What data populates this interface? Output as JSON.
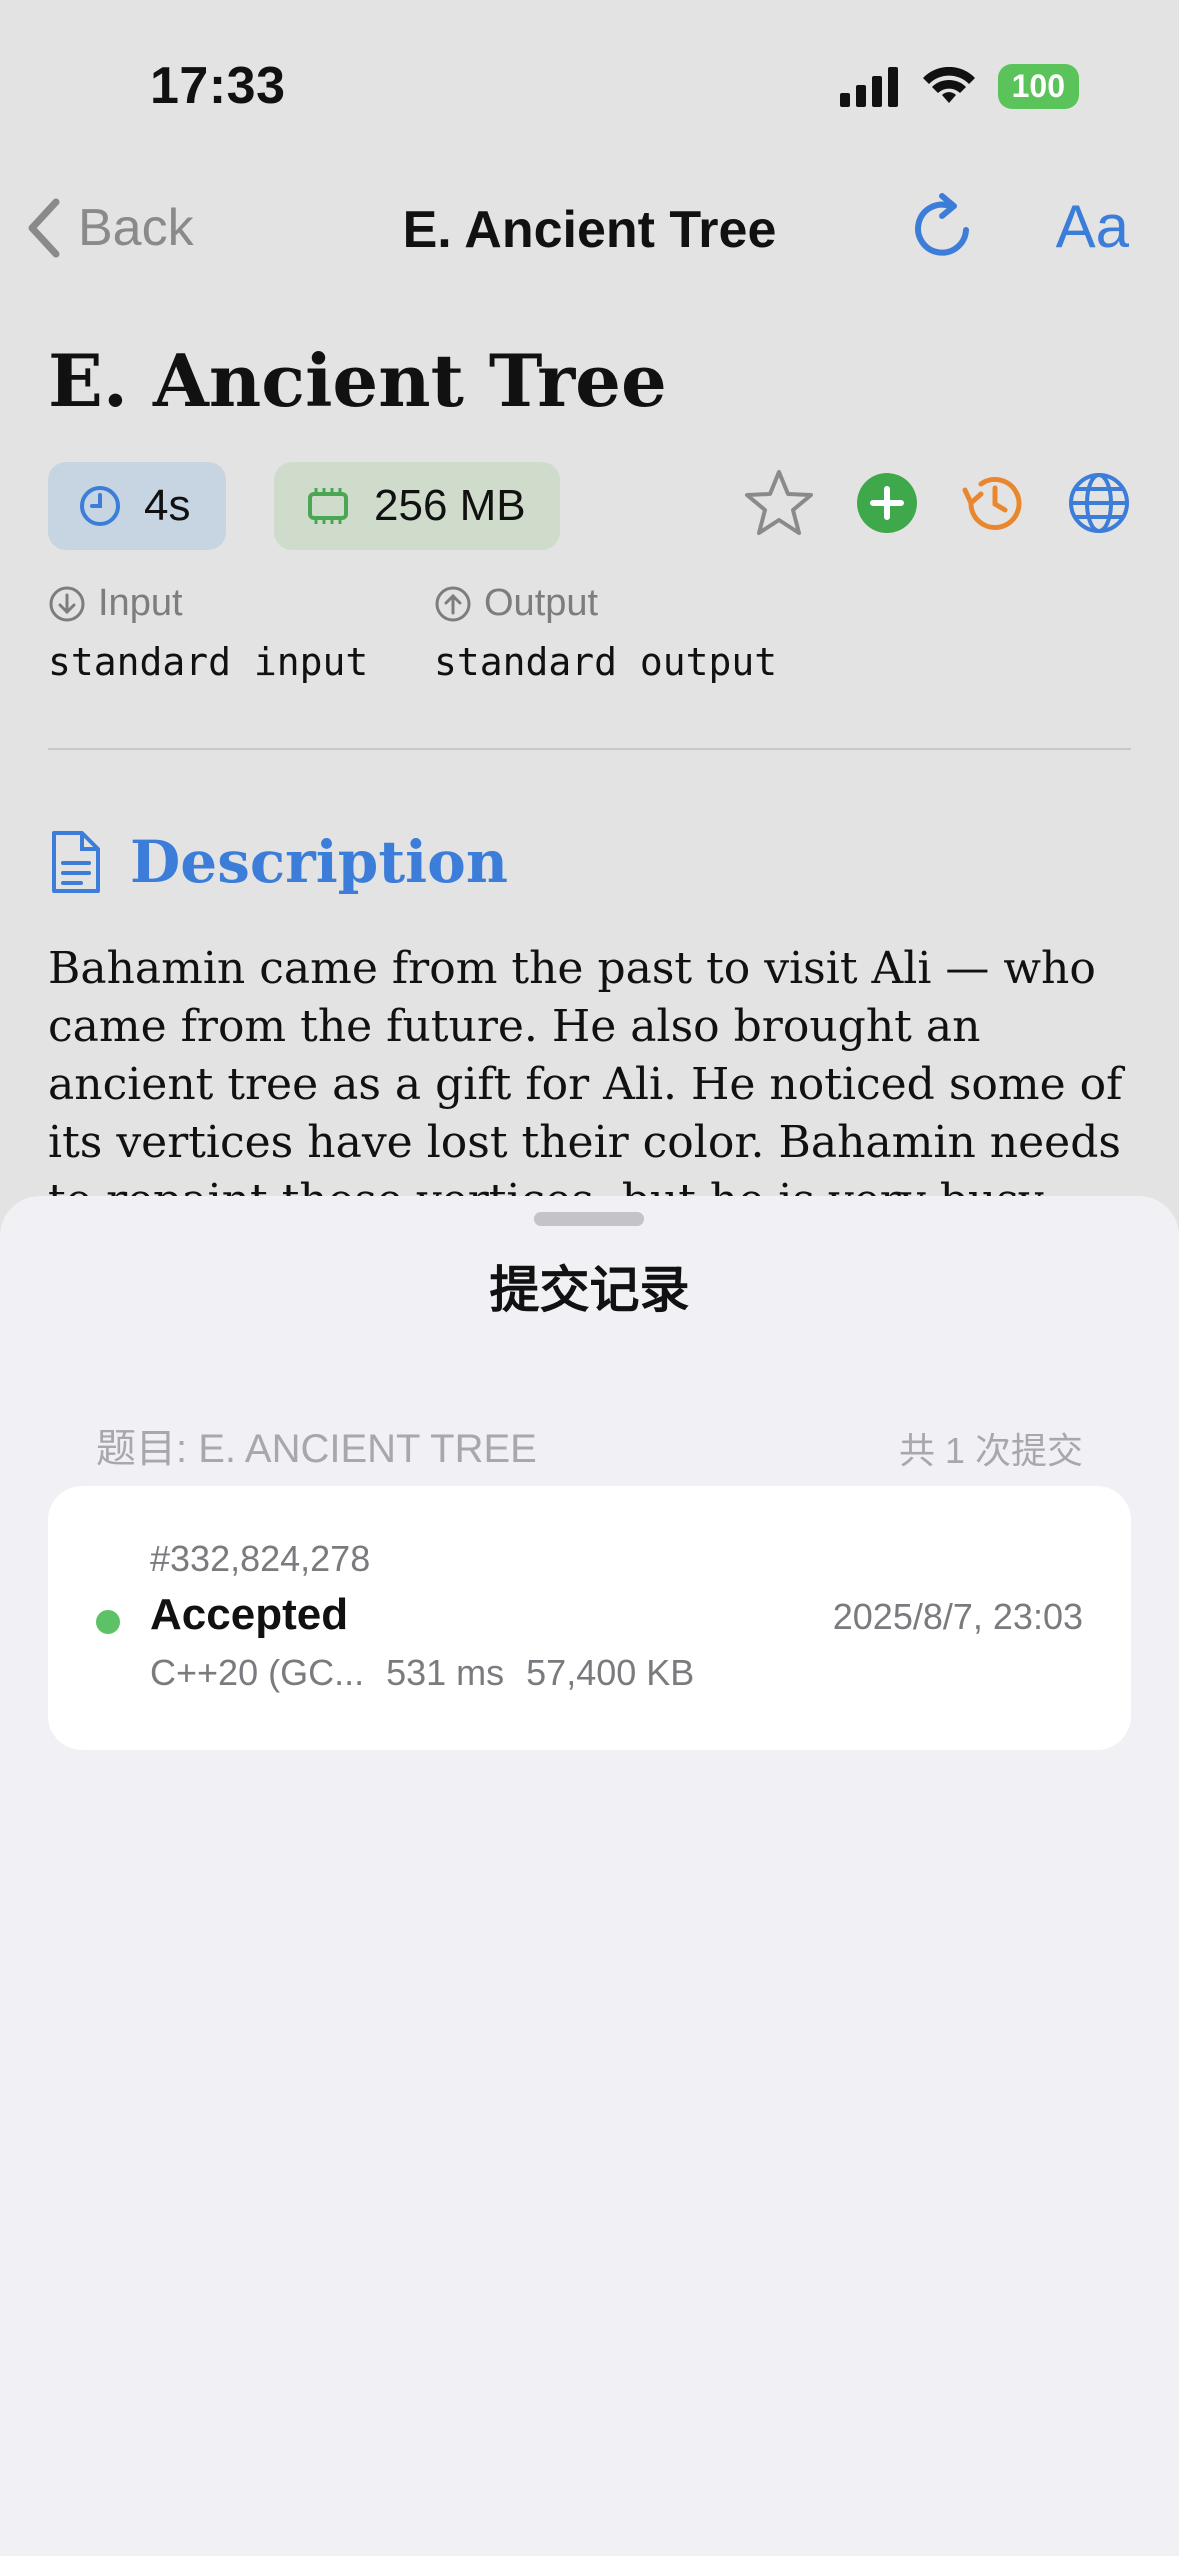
{
  "status_bar": {
    "time": "17:33",
    "battery": "100"
  },
  "nav": {
    "back_label": "Back",
    "title": "E. Ancient Tree",
    "font_button": "Aa"
  },
  "problem": {
    "title": "E. Ancient Tree",
    "time_limit": "4s",
    "memory_limit": "256 MB",
    "input_label": "Input",
    "input_value": "standard input",
    "output_label": "Output",
    "output_value": "standard output",
    "description_heading": "Description",
    "description_text": "Bahamin came from the past to visit Ali — who came from the future. He also brought an ancient tree as a gift for Ali. He noticed some of its vertices have lost their color. Bahamin needs to repaint those vertices, but he is very busy with"
  },
  "sheet": {
    "title": "提交记录",
    "problem_label": "题目: E. ANCIENT TREE",
    "count_label": "共 1 次提交",
    "submissions": [
      {
        "id": "#332,824,278",
        "verdict": "Accepted",
        "datetime": "2025/8/7, 23:03",
        "language": "C++20 (GC...",
        "time": "531 ms",
        "memory": "57,400 KB",
        "status_color": "#5cc265"
      }
    ]
  },
  "colors": {
    "accent": "#3b7dd8",
    "accepted": "#5cc265",
    "history": "#e8872e",
    "add": "#3fa84a"
  }
}
